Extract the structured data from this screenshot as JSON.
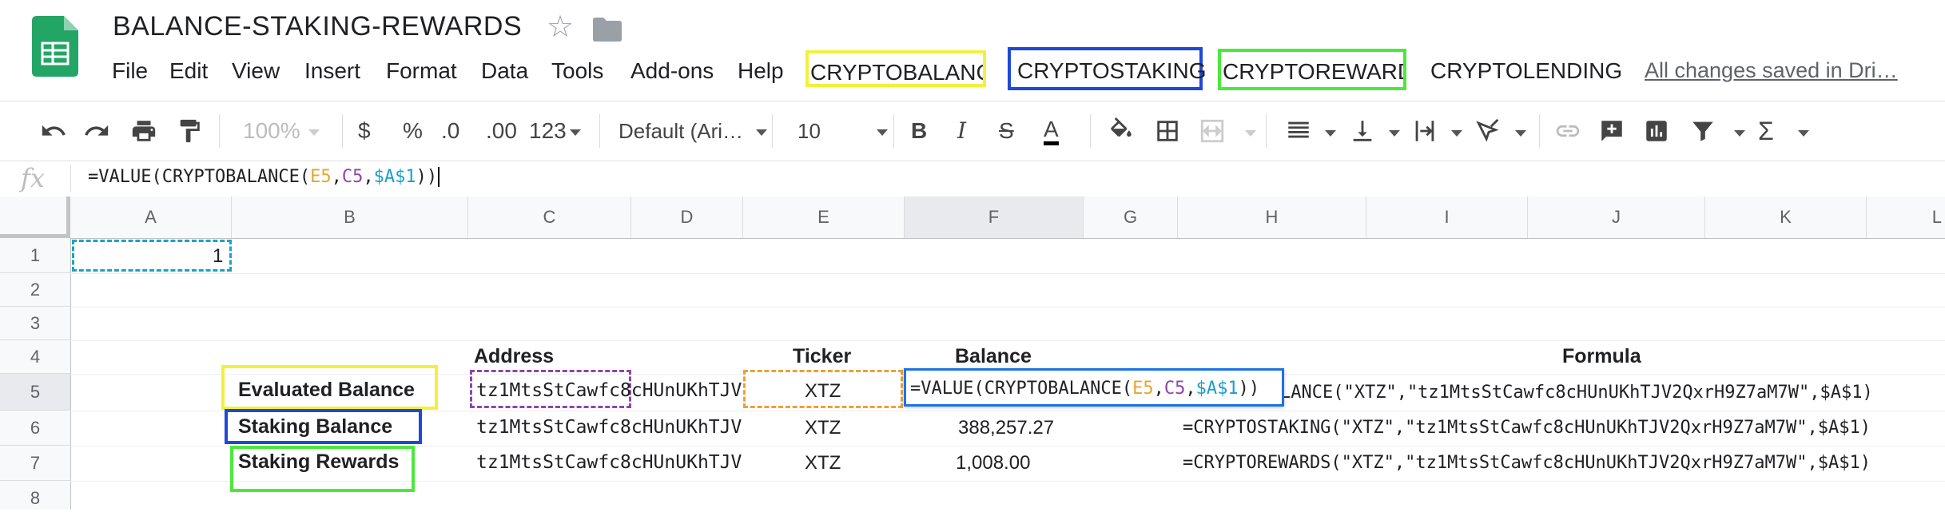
{
  "doc": {
    "title": "BALANCE-STAKING-REWARDS"
  },
  "menu": {
    "items": [
      "File",
      "Edit",
      "View",
      "Insert",
      "Format",
      "Data",
      "Tools",
      "Add-ons",
      "Help"
    ],
    "addons": [
      "CRYPTOBALANCE",
      "CRYPTOSTAKING",
      "CRYPTOREWARDS",
      "CRYPTOLENDING"
    ],
    "saved_status": "All changes saved in Dri…"
  },
  "toolbar": {
    "zoom": "100%",
    "currency": "$",
    "percent": "%",
    "decrease_decimal": ".0",
    "increase_decimal": ".00",
    "number_format": "123",
    "font": "Default (Ari…",
    "font_size": "10"
  },
  "formula_bar": {
    "fx": "fx",
    "p1": "=VALUE(CRYPTOBALANCE(",
    "ref1": "E5",
    "comma1": ",",
    "ref2": "C5",
    "comma2": ",",
    "ref3": "$A$1",
    "close": "))"
  },
  "columns": [
    "A",
    "B",
    "C",
    "D",
    "E",
    "F",
    "G",
    "H",
    "I",
    "J",
    "K",
    "L"
  ],
  "rows": [
    "1",
    "2",
    "3",
    "4",
    "5",
    "6",
    "7",
    "8"
  ],
  "cells": {
    "a1": "1",
    "headers": {
      "address": "Address",
      "ticker": "Ticker",
      "balance": "Balance",
      "formula": "Formula"
    },
    "rows": [
      {
        "label": "Evaluated Balance",
        "address": "tz1MtsStCawfc8cHUnUKhTJV",
        "ticker": "XTZ",
        "balance_edit": {
          "p1": "=VALUE(CRYPTOBALANCE(",
          "ref1": "E5",
          "comma1": ",",
          "ref2": "C5",
          "comma2": ",",
          "ref3": "$A$1",
          "close": "))"
        },
        "formula": "LANCE(\"XTZ\",\"tz1MtsStCawfc8cHUnUKhTJV2QxrH9Z7aM7W\",$A$1)"
      },
      {
        "label": "Staking Balance",
        "address": "tz1MtsStCawfc8cHUnUKhTJV",
        "ticker": "XTZ",
        "balance": "388,257.27",
        "formula": "=CRYPTOSTAKING(\"XTZ\",\"tz1MtsStCawfc8cHUnUKhTJV2QxrH9Z7aM7W\",$A$1)"
      },
      {
        "label": "Staking Rewards",
        "address": "tz1MtsStCawfc8cHUnUKhTJV",
        "ticker": "XTZ",
        "balance": "1,008.00",
        "formula": "=CRYPTOREWARDS(\"XTZ\",\"tz1MtsStCawfc8cHUnUKhTJV2QxrH9Z7aM7W\",$A$1)"
      }
    ]
  },
  "colors": {
    "yellow": "#f3f03a",
    "blue": "#1e48d8",
    "green": "#4ce83c",
    "dash_cyan": "#1aa3c8",
    "dash_purple": "#8e44ad",
    "dash_orange": "#f0a030",
    "active_cell": "#1a73e8"
  }
}
